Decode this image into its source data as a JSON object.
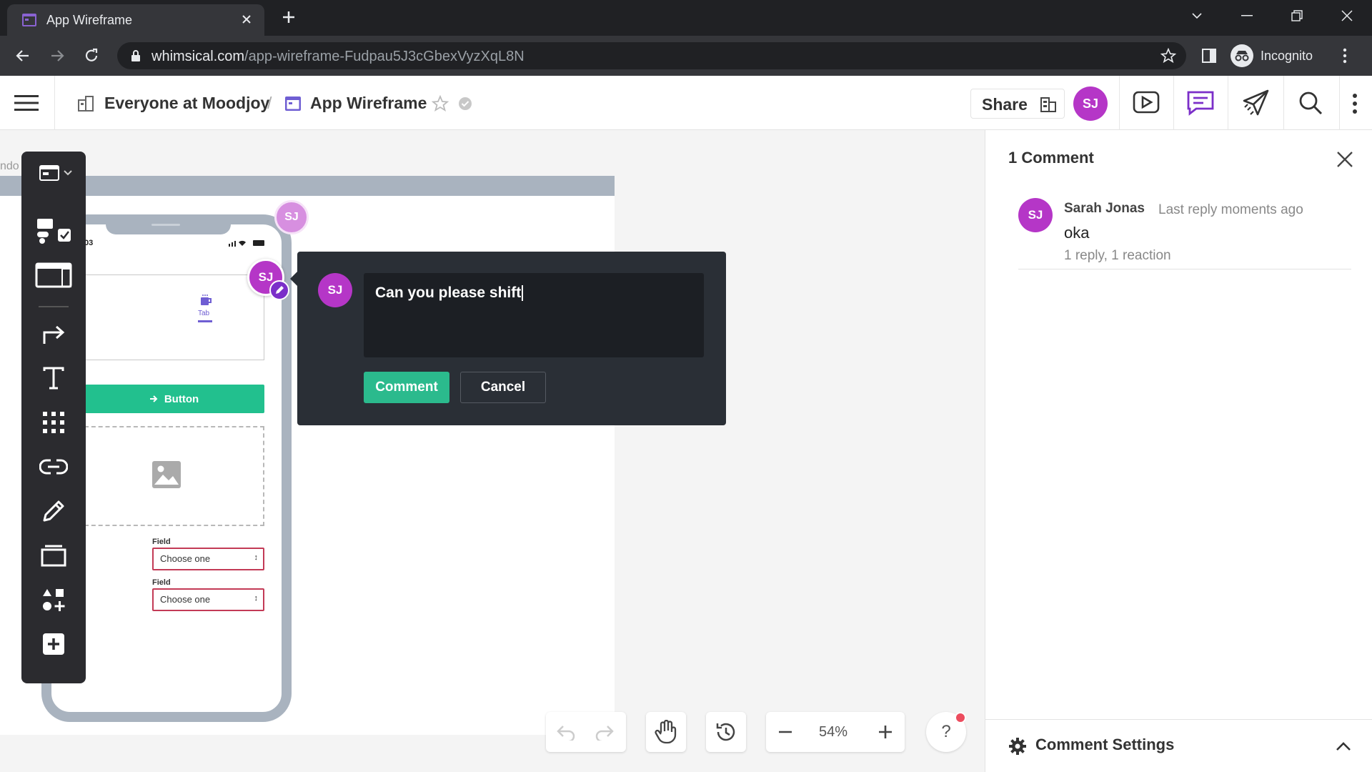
{
  "browser": {
    "tab_title": "App Wireframe",
    "url_host": "whimsical.com",
    "url_path": "/app-wireframe-Fudpau5J3cGbexVyzXqL8N",
    "profile_label": "Incognito"
  },
  "header": {
    "workspace": "Everyone at Moodjoy",
    "separator": "/",
    "doc_title": "App Wireframe",
    "share_label": "Share",
    "user_initials": "SJ"
  },
  "canvas": {
    "frame_label": "ndo",
    "phone_status_time": "03",
    "tab_label": "Tab",
    "button_label": "Button",
    "field1_label": "Field",
    "field1_value": "Choose one",
    "field2_label": "Field",
    "field2_value": "Choose one",
    "cursor_initials": "SJ",
    "pin_initials": "SJ"
  },
  "comment_popup": {
    "avatar_initials": "SJ",
    "input_text": "Can you please shift",
    "submit_label": "Comment",
    "cancel_label": "Cancel"
  },
  "bottom_bar": {
    "zoom": "54%",
    "help": "?"
  },
  "panel": {
    "title": "1 Comment",
    "thread": {
      "initials": "SJ",
      "author": "Sarah Jonas",
      "time": "Last reply moments ago",
      "text": "oka",
      "meta": "1 reply, 1 reaction"
    },
    "settings_label": "Comment Settings"
  },
  "colors": {
    "accent_purple": "#b536c7",
    "accent_green": "#2bba8d",
    "field_border": "#c33a56",
    "popup_bg": "#2a2f36"
  }
}
